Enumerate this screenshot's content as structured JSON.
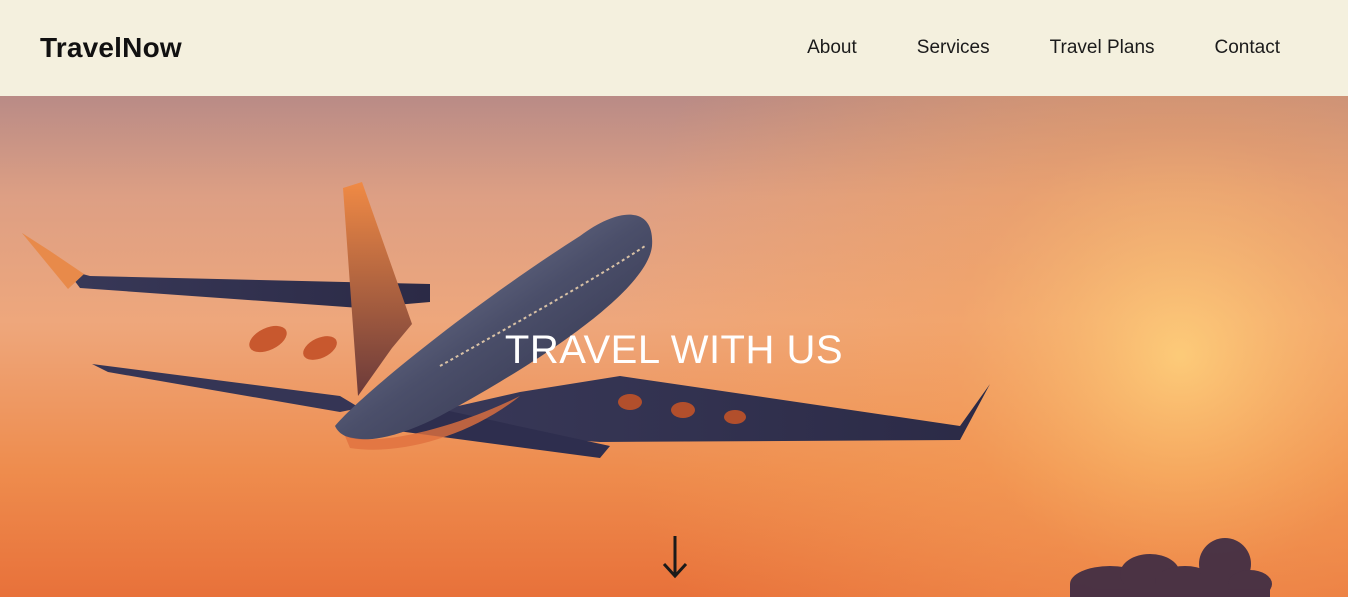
{
  "header": {
    "brand": "TravelNow",
    "nav": [
      {
        "label": "About"
      },
      {
        "label": "Services"
      },
      {
        "label": "Travel Plans"
      },
      {
        "label": "Contact"
      }
    ]
  },
  "hero": {
    "title": "TRAVEL WITH US",
    "scroll_icon": "arrow-down-icon",
    "image": "airplane-sunset-image"
  },
  "colors": {
    "header_bg": "#f4f0de",
    "text_dark": "#111111",
    "hero_text": "#ffffff",
    "sky_top": "#b98b86",
    "sky_bottom": "#e8713a"
  }
}
